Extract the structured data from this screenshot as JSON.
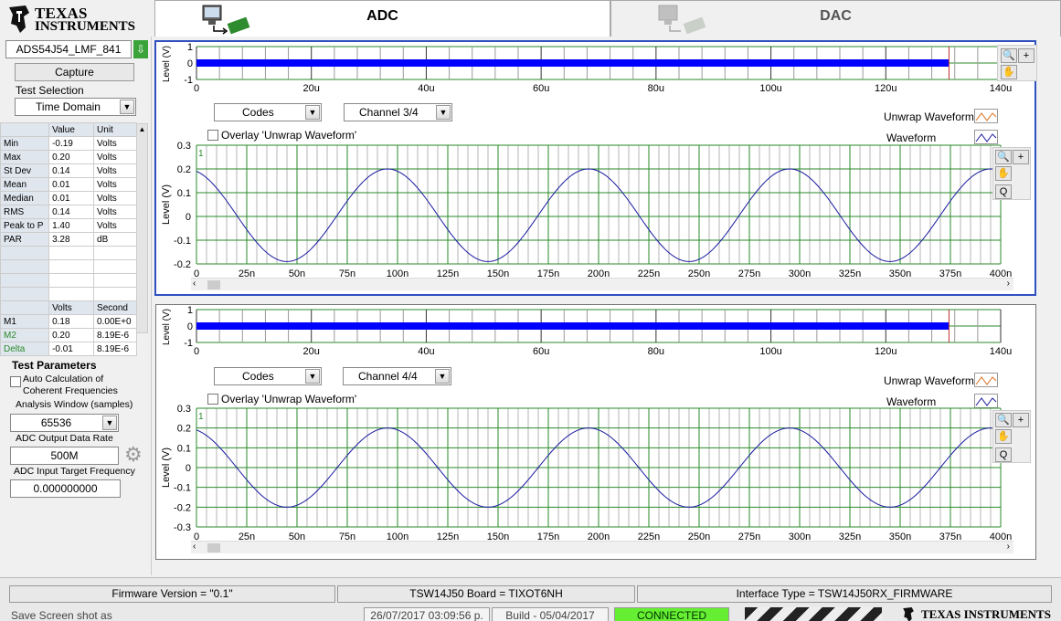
{
  "brand": {
    "line1": "TEXAS",
    "line2": "INSTRUMENTS",
    "footer": "TEXAS INSTRUMENTS"
  },
  "tabs": [
    {
      "label": "ADC",
      "active": true
    },
    {
      "label": "DAC",
      "active": false
    }
  ],
  "left": {
    "device": "ADS54J54_LMF_841",
    "capture_label": "Capture",
    "test_selection_label": "Test Selection",
    "test_selection_value": "Time Domain",
    "stats_headers": [
      "",
      "Value",
      "Unit"
    ],
    "stats": [
      {
        "name": "Min",
        "value": "-0.19",
        "unit": "Volts"
      },
      {
        "name": "Max",
        "value": "0.20",
        "unit": "Volts"
      },
      {
        "name": "St Dev",
        "value": "0.14",
        "unit": "Volts"
      },
      {
        "name": "Mean",
        "value": "0.01",
        "unit": "Volts"
      },
      {
        "name": "Median",
        "value": "0.01",
        "unit": "Volts"
      },
      {
        "name": "RMS",
        "value": "0.14",
        "unit": "Volts"
      },
      {
        "name": "Peak to P",
        "value": "1.40",
        "unit": "Volts"
      },
      {
        "name": "PAR",
        "value": "3.28",
        "unit": "dB"
      }
    ],
    "marker_headers": [
      "",
      "Volts",
      "Second"
    ],
    "markers": [
      {
        "name": "M1",
        "volts": "0.18",
        "second": "0.00E+0",
        "color": "#000000"
      },
      {
        "name": "M2",
        "volts": "0.20",
        "second": "8.19E-6",
        "color": "#2a8a2a"
      },
      {
        "name": "Delta",
        "volts": "-0.01",
        "second": "8.19E-6",
        "color": "#2a8a2a"
      }
    ],
    "test_params_label": "Test Parameters",
    "auto_calc_label1": "Auto Calculation of",
    "auto_calc_label2": "Coherent Frequencies",
    "analysis_window_label": "Analysis Window (samples)",
    "analysis_window_value": "65536",
    "output_rate_label": "ADC Output Data Rate",
    "output_rate_value": "500M",
    "input_freq_label": "ADC Input Target Frequency",
    "input_freq_value": "0.000000000"
  },
  "plots": [
    {
      "codes_label": "Codes",
      "channel_label": "Channel 3/4",
      "overlay_label": "Overlay 'Unwrap Waveform'",
      "legend_unwrap": "Unwrap Waveform",
      "legend_wave": "Waveform",
      "top_ylabel": "Level (V)",
      "bottom_ylabel": "Level (V)",
      "plot_marker": "1"
    },
    {
      "codes_label": "Codes",
      "channel_label": "Channel 4/4",
      "overlay_label": "Overlay 'Unwrap Waveform'",
      "legend_unwrap": "Unwrap Waveform",
      "legend_wave": "Waveform",
      "top_ylabel": "Level (V)",
      "bottom_ylabel": "Level (V)",
      "plot_marker": "1"
    }
  ],
  "chart_data": [
    {
      "type": "line",
      "ylabel": "Level (V)",
      "ylim": [
        -1,
        1
      ],
      "yticks": [
        "1",
        "0",
        "-1"
      ],
      "xticks": [
        "0",
        "20u",
        "40u",
        "60u",
        "80u",
        "100u",
        "120u",
        "140u"
      ],
      "xlim": [
        0,
        140
      ],
      "band_end_x": 131,
      "band_color": "#0000ff",
      "cursor_x": 131
    },
    {
      "type": "line",
      "ylabel": "Level (V)",
      "ylim": [
        -0.2,
        0.3
      ],
      "yticks": [
        "0.3",
        "0.2",
        "0.1",
        "0",
        "-0.1",
        "-0.2"
      ],
      "xticks": [
        "0",
        "25n",
        "50n",
        "75n",
        "100n",
        "125n",
        "150n",
        "175n",
        "200n",
        "225n",
        "250n",
        "275n",
        "300n",
        "325n",
        "350n",
        "375n",
        "400n"
      ],
      "xlim": [
        0,
        400
      ],
      "amplitude": 0.195,
      "offset": 0.005,
      "period": 100,
      "peak_at": 95,
      "line_color": "#1a1aa0"
    },
    {
      "type": "line",
      "ylabel": "Level (V)",
      "ylim": [
        -1,
        1
      ],
      "yticks": [
        "1",
        "0",
        "-1"
      ],
      "xticks": [
        "0",
        "20u",
        "40u",
        "60u",
        "80u",
        "100u",
        "120u",
        "140u"
      ],
      "xlim": [
        0,
        140
      ],
      "band_end_x": 131,
      "band_color": "#0000ff",
      "cursor_x": 131
    },
    {
      "type": "line",
      "ylabel": "Level (V)",
      "ylim": [
        -0.3,
        0.3
      ],
      "yticks": [
        "0.3",
        "0.2",
        "0.1",
        "0",
        "-0.1",
        "-0.2",
        "-0.3"
      ],
      "xticks": [
        "0",
        "25n",
        "50n",
        "75n",
        "100n",
        "125n",
        "150n",
        "175n",
        "200n",
        "225n",
        "250n",
        "275n",
        "300n",
        "325n",
        "350n",
        "375n",
        "400n"
      ],
      "xlim": [
        0,
        400
      ],
      "amplitude": 0.2,
      "offset": 0.0,
      "period": 100,
      "peak_at": 95,
      "line_color": "#1a1aa0"
    }
  ],
  "status": {
    "firmware": "Firmware Version = \"0.1\"",
    "board": "TSW14J50 Board = TIXOT6NH",
    "interface": "Interface Type = TSW14J50RX_FIRMWARE",
    "save": "Save Screen shot as",
    "datetime": "26/07/2017 03:09:56 p.",
    "build": "Build  - 05/04/2017",
    "connection": "CONNECTED"
  },
  "colors": {
    "accent": "#3050c0",
    "grid": "#2a8a2a",
    "connected": "#66ee33"
  }
}
